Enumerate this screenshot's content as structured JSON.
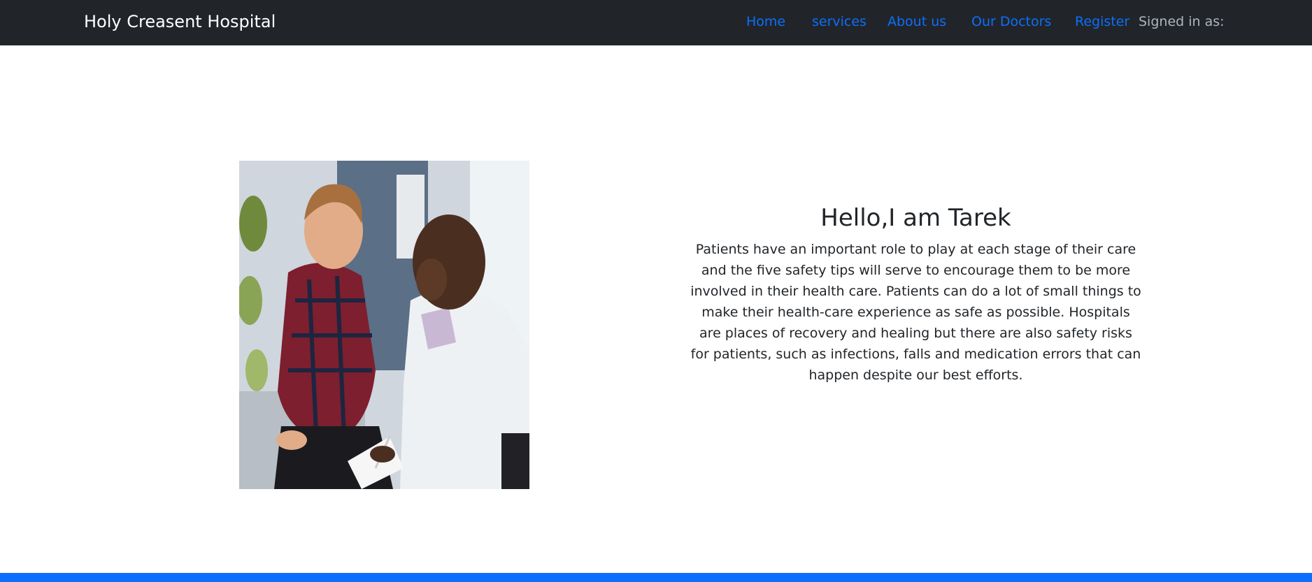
{
  "navbar": {
    "brand": "Holy Creasent Hospital",
    "links": [
      {
        "label": "Home"
      },
      {
        "label": "services"
      },
      {
        "label": "About us"
      },
      {
        "label": "Our Doctors"
      },
      {
        "label": "Register"
      }
    ],
    "signed_in_text": "Signed in as:",
    "link_color": "#0d6efd",
    "bg_color": "#212529"
  },
  "hero": {
    "title": "Hello,I am Tarek",
    "paragraph": "Patients have an important role to play at each stage of their care and the five safety tips will serve to encourage them to be more involved in their health care. Patients can do a lot of small things to make their health-care experience as safe as possible. Hospitals are places of recovery and healing but there are also safety risks for patients, such as infections, falls and medication errors that can happen despite our best efforts.",
    "image_icon": "doctor-patient-photo"
  },
  "footer": {
    "bar_color": "#0d6efd"
  }
}
